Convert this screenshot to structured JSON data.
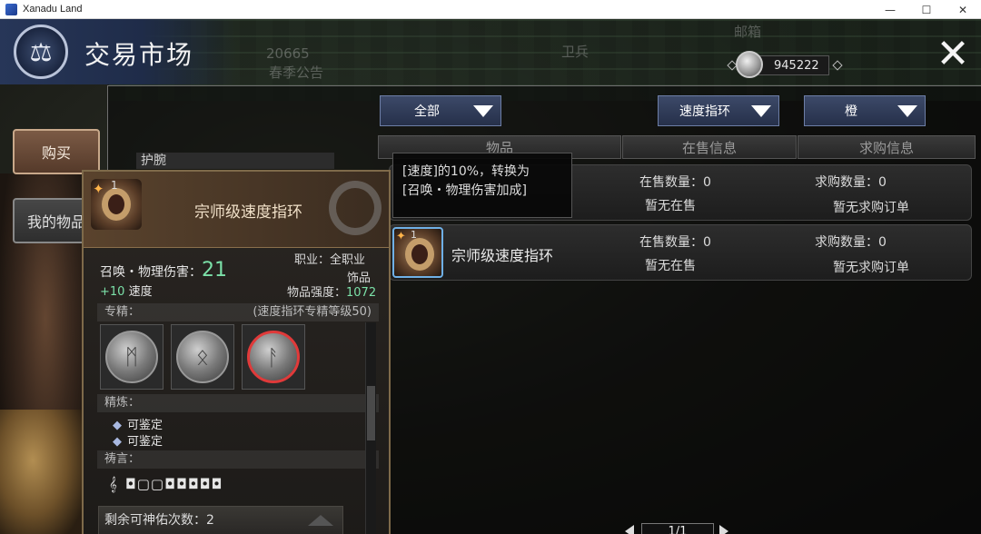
{
  "window": {
    "title": "Xanadu Land",
    "min": "—",
    "max": "☐",
    "close": "✕"
  },
  "header": {
    "title": "交易市场",
    "emblem_icon": "scales-icon",
    "coins": "945222"
  },
  "background_text": {
    "count": "20665",
    "notice": "春季公告",
    "mailbox": "邮箱",
    "guard": "卫兵"
  },
  "sidebar": {
    "buy_label": "购买",
    "my_items_label": "我的物品"
  },
  "filters": {
    "all": "全部",
    "type": "速度指环",
    "quality": "橙"
  },
  "columns": {
    "item": "物品",
    "on_sale": "在售信息",
    "wanted": "求购信息"
  },
  "category": "护腕",
  "rows": [
    {
      "name": "",
      "sale_count": "在售数量：0",
      "sale_status": "暂无在售",
      "buy_count": "求购数量：0",
      "buy_status": "暂无求购订单"
    },
    {
      "name": "宗师级速度指环",
      "level": "1",
      "sale_count": "在售数量：0",
      "sale_status": "暂无在售",
      "buy_count": "求购数量：0",
      "buy_status": "暂无求购订单"
    }
  ],
  "skill_tooltip": {
    "line1": "[速度]的10%，转换为",
    "line2": "[召唤・物理伤害加成]"
  },
  "item_panel": {
    "level": "1",
    "name": "宗师级速度指环",
    "stat_label": "召唤・物理伤害：",
    "stat_value": "21",
    "sub_plus": "+10",
    "sub_label": " 速度",
    "class": "职业：全职业",
    "slot": "饰品",
    "power_label": "物品强度：",
    "power_value": "1072",
    "mastery_label": "专精：",
    "mastery_req": "(速度指环专精等级50)",
    "refine_label": "精炼：",
    "refine_items": [
      "可鉴定",
      "可鉴定"
    ],
    "prayer_label": "祷言：",
    "prayer_runes": "◘▢▢◘◘◘◘◘",
    "blessings_label": "剩余可神佑次数：",
    "blessings_value": "2"
  },
  "pager": {
    "text": "1/1"
  }
}
